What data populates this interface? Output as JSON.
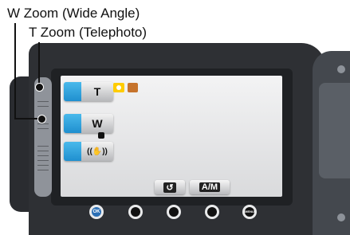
{
  "callouts": {
    "w_zoom": "W Zoom (Wide Angle)",
    "t_zoom": "T Zoom (Telephoto)"
  },
  "screen": {
    "buttons": [
      {
        "label": "T"
      },
      {
        "label": "W"
      },
      {
        "label": "((✋))"
      }
    ],
    "tabs": [
      {
        "label": "↺"
      },
      {
        "label": "A/M"
      }
    ]
  },
  "hardware_buttons": {
    "ok": "OK",
    "menu": "MENU"
  },
  "colors": {
    "accent_blue": "#2ba3dd",
    "camera_body": "#2e3034",
    "mode_icon": "#ffcc00",
    "card_icon": "#c6732c"
  },
  "icons": [
    "camera-mode-icon",
    "memory-card-icon",
    "hand-shake-icon",
    "return-icon"
  ]
}
